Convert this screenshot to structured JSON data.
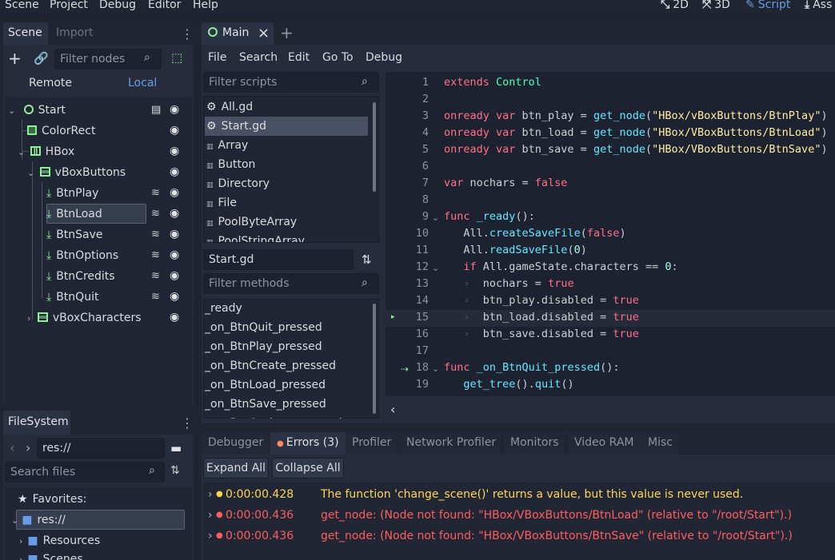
{
  "menubar": {
    "items": [
      "Scene",
      "Project",
      "Debug",
      "Editor",
      "Help"
    ],
    "workspaces": [
      {
        "icon": "2d-icon",
        "label": "2D"
      },
      {
        "icon": "3d-icon",
        "label": "3D"
      },
      {
        "icon": "script-icon",
        "label": "Script",
        "active": true
      },
      {
        "icon": "asset-icon",
        "label": "Ass"
      }
    ]
  },
  "scene_dock": {
    "tabs": [
      "Scene",
      "Import"
    ],
    "filter_placeholder": "Filter nodes",
    "remote_label": "Remote",
    "local_label": "Local",
    "nodes": [
      {
        "label": "Start",
        "icon": "control-icon",
        "depth": 0,
        "arrow": "down",
        "script": true
      },
      {
        "label": "ColorRect",
        "icon": "colorrect-icon",
        "depth": 1
      },
      {
        "label": "HBox",
        "icon": "hbox-icon",
        "depth": 1,
        "arrow": "down"
      },
      {
        "label": "vBoxButtons",
        "icon": "vbox-icon",
        "depth": 2,
        "arrow": "down"
      },
      {
        "label": "BtnPlay",
        "icon": "button-icon",
        "depth": 3,
        "signal": true
      },
      {
        "label": "BtnLoad",
        "icon": "button-icon",
        "depth": 3,
        "signal": true,
        "selected": true
      },
      {
        "label": "BtnSave",
        "icon": "button-icon",
        "depth": 3,
        "signal": true
      },
      {
        "label": "BtnOptions",
        "icon": "button-icon",
        "depth": 3,
        "signal": true
      },
      {
        "label": "BtnCredits",
        "icon": "button-icon",
        "depth": 3,
        "signal": true
      },
      {
        "label": "BtnQuit",
        "icon": "button-icon",
        "depth": 3,
        "signal": true
      },
      {
        "label": "vBoxCharacters",
        "icon": "vbox-icon",
        "depth": 2,
        "arrow": "right"
      }
    ]
  },
  "filesystem": {
    "tab": "FileSystem",
    "path": "res://",
    "search_placeholder": "Search files",
    "favorites_label": "Favorites:",
    "root_label": "res://",
    "folders": [
      "Resources",
      "Scenes"
    ]
  },
  "editor_tabs": {
    "main_label": "Main"
  },
  "script_menu": [
    "File",
    "Search",
    "Edit",
    "Go To",
    "Debug"
  ],
  "scripts": {
    "filter_placeholder": "Filter scripts",
    "items": [
      {
        "label": "All.gd",
        "icon": "gear-icon"
      },
      {
        "label": "Start.gd",
        "icon": "gear-icon",
        "selected": true
      },
      {
        "label": "Array",
        "icon": "doc-icon"
      },
      {
        "label": "Button",
        "icon": "doc-icon"
      },
      {
        "label": "Directory",
        "icon": "doc-icon"
      },
      {
        "label": "File",
        "icon": "doc-icon"
      },
      {
        "label": "PoolByteArray",
        "icon": "doc-icon"
      },
      {
        "label": "PoolStringArray",
        "icon": "doc-icon"
      }
    ]
  },
  "methods": {
    "current_script": "Start.gd",
    "filter_placeholder": "Filter methods",
    "items": [
      "_ready",
      "_on_BtnQuit_pressed",
      "_on_BtnPlay_pressed",
      "_on_BtnCreate_pressed",
      "_on_BtnLoad_pressed",
      "_on_BtnSave_pressed",
      "_on_BtnOptions_pressed"
    ]
  },
  "code": {
    "line_numbers": [
      "1",
      "2",
      "3",
      "4",
      "5",
      "6",
      "7",
      "8",
      "9",
      "10",
      "11",
      "12",
      "13",
      "14",
      "15",
      "16",
      "17",
      "18",
      "19"
    ],
    "lines": [
      {
        "indent": 0,
        "tokens": [
          [
            "kw",
            "extends"
          ],
          [
            "",
            ""
          ],
          [
            "ty",
            " Control"
          ]
        ]
      },
      {
        "indent": 0,
        "tokens": []
      },
      {
        "indent": 0,
        "tokens": [
          [
            "kw",
            "onready var"
          ],
          [
            "",
            " btn_play = "
          ],
          [
            "fn",
            "get_node"
          ],
          [
            "",
            "("
          ],
          [
            "str",
            "\"HBox/vBoxButtons/BtnPlay\""
          ],
          [
            "",
            ")"
          ]
        ]
      },
      {
        "indent": 0,
        "tokens": [
          [
            "kw",
            "onready var"
          ],
          [
            "",
            " btn_load = "
          ],
          [
            "fn",
            "get_node"
          ],
          [
            "",
            "("
          ],
          [
            "str",
            "\"HBox/VBoxButtons/BtnLoad\""
          ],
          [
            "",
            ")"
          ]
        ]
      },
      {
        "indent": 0,
        "tokens": [
          [
            "kw",
            "onready var"
          ],
          [
            "",
            " btn_save = "
          ],
          [
            "fn",
            "get_node"
          ],
          [
            "",
            "("
          ],
          [
            "str",
            "\"HBox/VBoxButtons/BtnSave\""
          ],
          [
            "",
            ")"
          ]
        ]
      },
      {
        "indent": 0,
        "tokens": []
      },
      {
        "indent": 0,
        "tokens": [
          [
            "kw",
            "var"
          ],
          [
            "",
            " nochars = "
          ],
          [
            "kw",
            "false"
          ]
        ]
      },
      {
        "indent": 0,
        "tokens": []
      },
      {
        "indent": 0,
        "tokens": [
          [
            "kw",
            "func"
          ],
          [
            "",
            " "
          ],
          [
            "fn",
            "_ready"
          ],
          [
            "",
            "():"
          ]
        ]
      },
      {
        "indent": 1,
        "tokens": [
          [
            "",
            "All."
          ],
          [
            "fn",
            "createSaveFile"
          ],
          [
            "",
            "("
          ],
          [
            "kw",
            "false"
          ],
          [
            "",
            ")"
          ]
        ]
      },
      {
        "indent": 1,
        "tokens": [
          [
            "",
            "All."
          ],
          [
            "fn",
            "readSaveFile"
          ],
          [
            "",
            "("
          ],
          [
            "num",
            "0"
          ],
          [
            "",
            ")"
          ]
        ]
      },
      {
        "indent": 1,
        "tokens": [
          [
            "kw",
            "if"
          ],
          [
            "",
            " All.gameState.characters == "
          ],
          [
            "num",
            "0"
          ],
          [
            "",
            ":"
          ]
        ]
      },
      {
        "indent": 2,
        "tokens": [
          [
            "",
            "nochars = "
          ],
          [
            "kw",
            "true"
          ]
        ]
      },
      {
        "indent": 2,
        "tokens": [
          [
            "",
            "btn_play.disabled = "
          ],
          [
            "kw",
            "true"
          ]
        ]
      },
      {
        "indent": 2,
        "tokens": [
          [
            "",
            "btn_load.disabled = "
          ],
          [
            "kw",
            "true"
          ]
        ]
      },
      {
        "indent": 2,
        "tokens": [
          [
            "",
            "btn_save.disabled = "
          ],
          [
            "kw",
            "true"
          ]
        ]
      },
      {
        "indent": 0,
        "tokens": []
      },
      {
        "indent": 0,
        "tokens": [
          [
            "kw",
            "func"
          ],
          [
            "",
            " "
          ],
          [
            "fn",
            "_on_BtnQuit_pressed"
          ],
          [
            "",
            "():"
          ]
        ]
      },
      {
        "indent": 1,
        "tokens": [
          [
            "fn",
            "get_tree"
          ],
          [
            "",
            "()."
          ],
          [
            "fn",
            "quit"
          ],
          [
            "",
            "()"
          ]
        ]
      }
    ]
  },
  "bottom": {
    "tabs": [
      "Debugger",
      "Errors (3)",
      "Profiler",
      "Network Profiler",
      "Monitors",
      "Video RAM",
      "Misc"
    ],
    "active_tab": 1,
    "expand_label": "Expand All",
    "collapse_label": "Collapse All",
    "errors": [
      {
        "level": "warning",
        "time": "0:00:00.428",
        "message": "The function 'change_scene()' returns a value, but this value is never used.",
        "color": "#ffd54f"
      },
      {
        "level": "error",
        "time": "0:00:00.436",
        "message": "get_node: (Node not found: \"HBox/VBoxButtons/BtnLoad\" (relative to \"/root/Start\").)",
        "color": "#ff5d5d"
      },
      {
        "level": "error",
        "time": "0:00:00.436",
        "message": "get_node: (Node not found: \"HBox/VBoxButtons/BtnSave\" (relative to \"/root/Start\").)",
        "color": "#ff5d5d"
      }
    ]
  },
  "colors": {
    "accent": "#699ce8",
    "node_green": "#8eef97",
    "keyword": "#ff7085",
    "function": "#66e6ff",
    "string": "#ffeda1"
  }
}
